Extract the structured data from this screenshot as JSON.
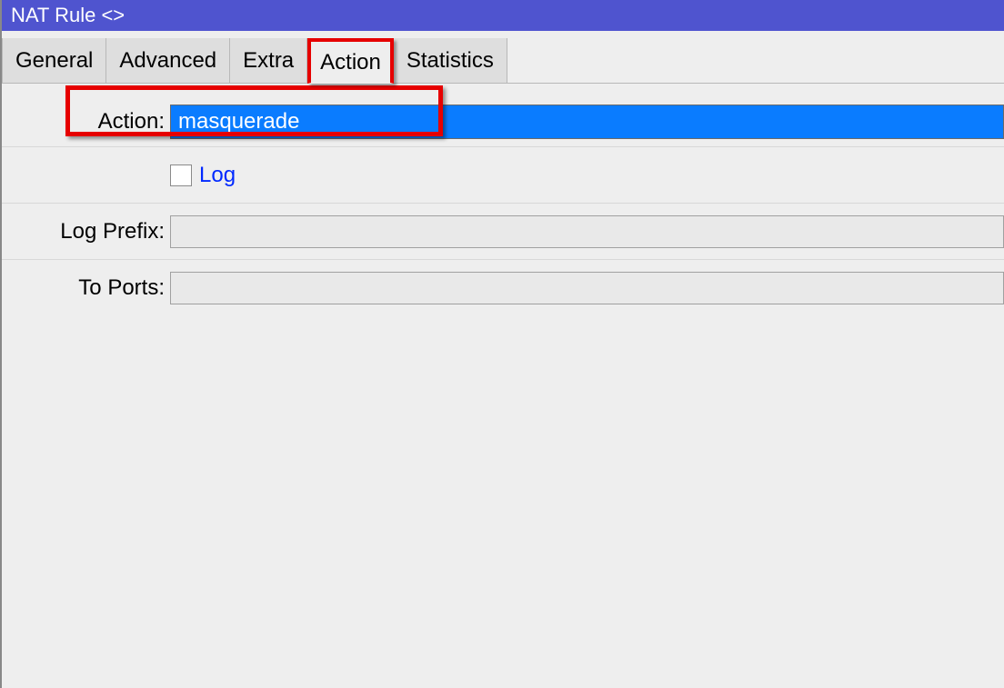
{
  "window": {
    "title": "NAT Rule <>"
  },
  "tabs": {
    "general": {
      "label": "General"
    },
    "advanced": {
      "label": "Advanced"
    },
    "extra": {
      "label": "Extra"
    },
    "action": {
      "label": "Action"
    },
    "statistics": {
      "label": "Statistics"
    }
  },
  "form": {
    "action": {
      "label": "Action:",
      "value": "masquerade"
    },
    "log": {
      "label": "Log",
      "checked": false
    },
    "log_prefix": {
      "label": "Log Prefix:",
      "value": ""
    },
    "to_ports": {
      "label": "To Ports:",
      "value": ""
    }
  }
}
